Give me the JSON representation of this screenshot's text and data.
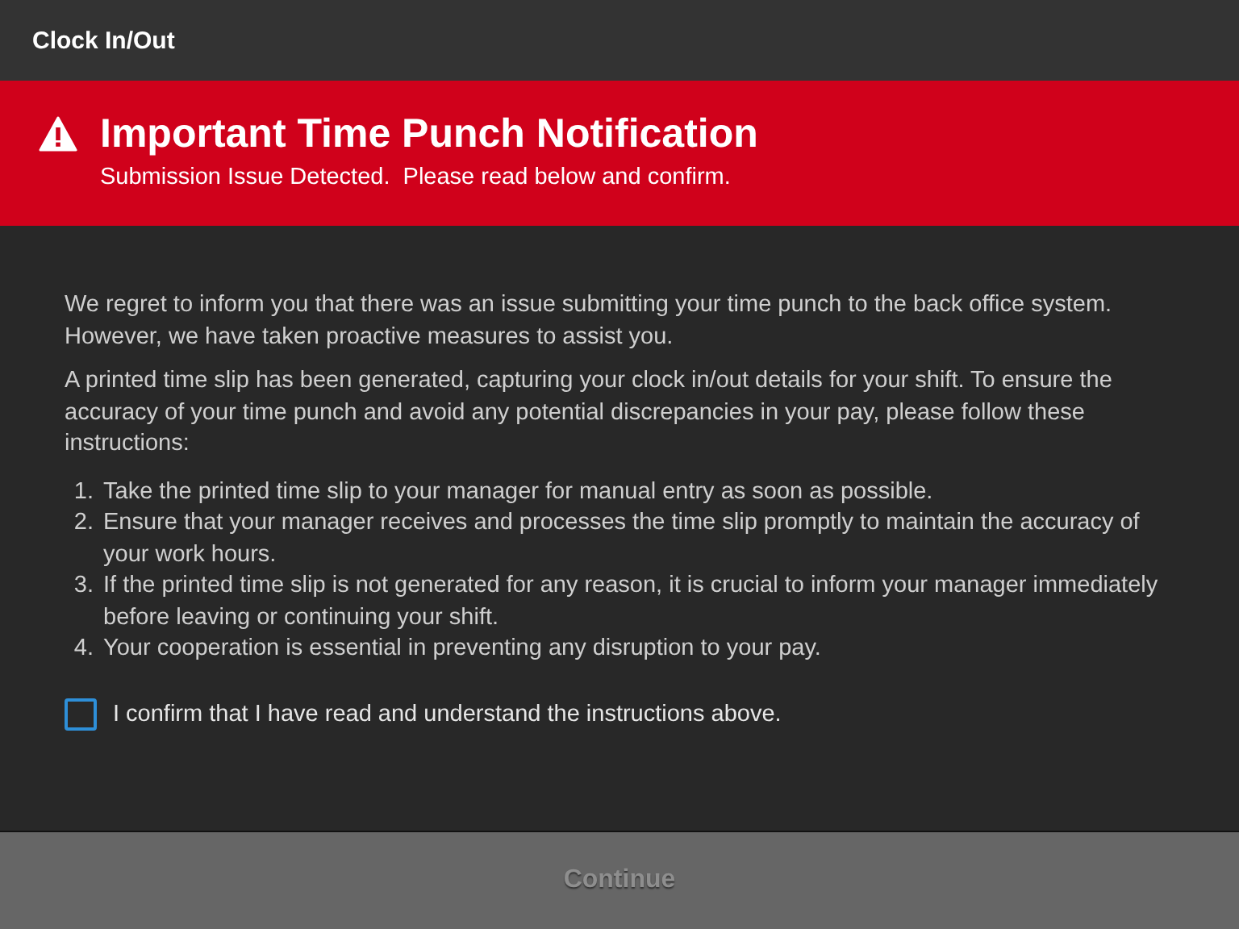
{
  "window": {
    "title": "Clock In/Out"
  },
  "banner": {
    "title": "Important Time Punch Notification",
    "subtitle": "Submission Issue Detected.  Please read below and confirm."
  },
  "paragraphs": [
    "We regret to inform you that there was an issue submitting your time punch to the back office system. However, we have taken proactive measures to assist you.",
    "A printed time slip has been generated, capturing your clock in/out details for your shift. To ensure the accuracy of your time punch and avoid any potential discrepancies in your pay, please follow these instructions:"
  ],
  "instructions": [
    {
      "number": "1.",
      "text": "Take the printed time slip to your manager for manual entry as soon as possible."
    },
    {
      "number": "2.",
      "text": "Ensure that your manager receives and processes the time slip promptly to maintain the accuracy of your work hours."
    },
    {
      "number": "3.",
      "text": "If the printed time slip is not generated for any reason, it is crucial to inform your manager immediately before leaving or continuing your shift."
    },
    {
      "number": "4.",
      "text": "Your cooperation is essential in preventing any disruption to your pay."
    }
  ],
  "confirm": {
    "label": "I confirm that I have read and understand the instructions above.",
    "checked": false
  },
  "continue_button": {
    "label": "Continue",
    "disabled": true
  }
}
